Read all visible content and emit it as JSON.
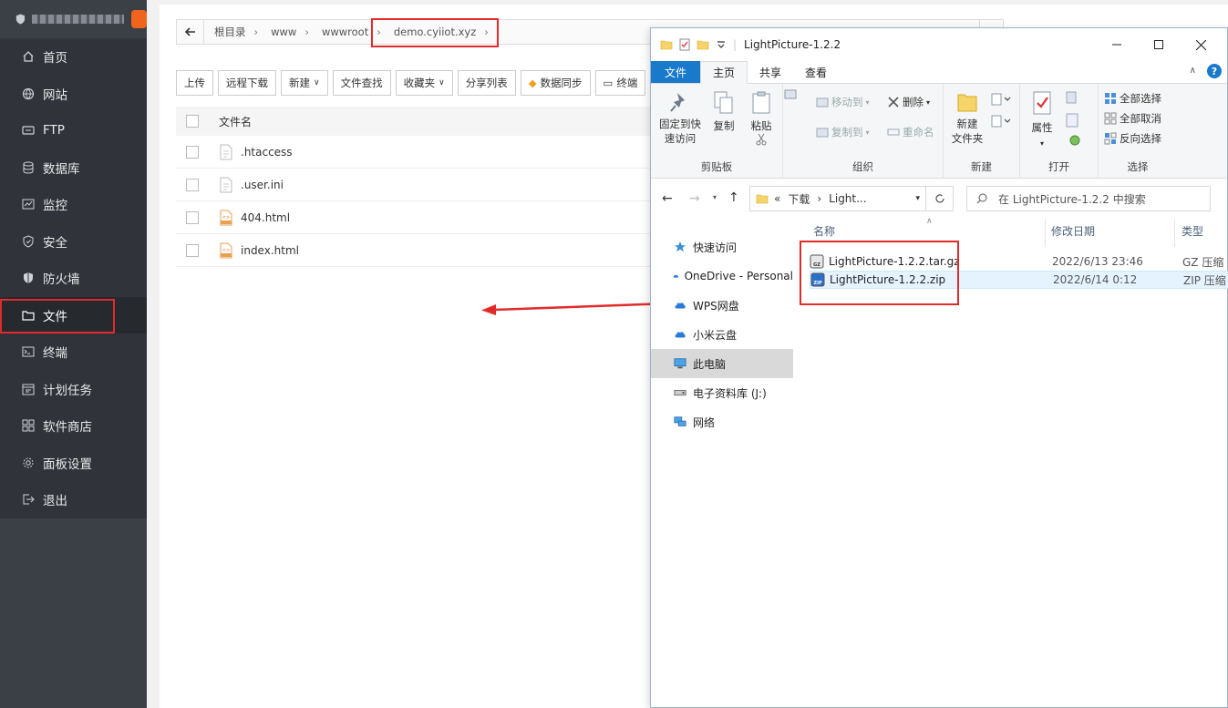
{
  "sidebar": {
    "items": [
      {
        "label": "首页",
        "icon": "home-icon"
      },
      {
        "label": "网站",
        "icon": "globe-icon"
      },
      {
        "label": "FTP",
        "icon": "ftp-icon"
      },
      {
        "label": "数据库",
        "icon": "database-icon"
      },
      {
        "label": "监控",
        "icon": "monitor-icon"
      },
      {
        "label": "安全",
        "icon": "shield-icon"
      },
      {
        "label": "防火墙",
        "icon": "firewall-icon"
      },
      {
        "label": "文件",
        "icon": "folder-icon"
      },
      {
        "label": "终端",
        "icon": "terminal-icon"
      },
      {
        "label": "计划任务",
        "icon": "calendar-icon"
      },
      {
        "label": "软件商店",
        "icon": "apps-icon"
      },
      {
        "label": "面板设置",
        "icon": "gear-icon"
      },
      {
        "label": "退出",
        "icon": "logout-icon"
      }
    ]
  },
  "filemanager": {
    "breadcrumb": [
      "根目录",
      "www",
      "wwwroot",
      "demo.cyiiot.xyz"
    ],
    "toolbar": [
      "上传",
      "远程下载",
      "新建",
      "文件查找",
      "收藏夹",
      "分享列表",
      "数据同步",
      "终端"
    ],
    "header_name": "文件名",
    "files": [
      {
        "name": ".htaccess",
        "type": "doc"
      },
      {
        "name": ".user.ini",
        "type": "doc"
      },
      {
        "name": "404.html",
        "type": "html"
      },
      {
        "name": "index.html",
        "type": "html"
      }
    ]
  },
  "explorer": {
    "title": "LightPicture-1.2.2",
    "tabs": [
      "文件",
      "主页",
      "共享",
      "查看"
    ],
    "help": "?",
    "ribbon": {
      "pin_label_1": "固定到快",
      "pin_label_2": "速访问",
      "copy": "复制",
      "paste": "粘贴",
      "clipboard_group": "剪贴板",
      "move_to": "移动到",
      "copy_to": "复制到",
      "delete": "删除",
      "rename": "重命名",
      "organize_group": "组织",
      "new_folder_1": "新建",
      "new_folder_2": "文件夹",
      "new_group": "新建",
      "properties": "属性",
      "open_group": "打开",
      "select_all": "全部选择",
      "select_none": "全部取消",
      "invert_select": "反向选择",
      "select_group": "选择"
    },
    "address": {
      "prefix": "«",
      "parts": [
        "下载",
        "Light..."
      ]
    },
    "search_placeholder": "在 LightPicture-1.2.2 中搜索",
    "nav": [
      {
        "label": "快速访问",
        "icon": "star-icon"
      },
      {
        "label": "OneDrive - Personal",
        "icon": "cloud-icon"
      },
      {
        "label": "WPS网盘",
        "icon": "cloud-icon"
      },
      {
        "label": "小米云盘",
        "icon": "cloud-icon"
      },
      {
        "label": "此电脑",
        "icon": "computer-icon"
      },
      {
        "label": "电子资料库 (J:)",
        "icon": "drive-icon"
      },
      {
        "label": "网络",
        "icon": "network-icon"
      }
    ],
    "columns": {
      "name": "名称",
      "date": "修改日期",
      "type": "类型"
    },
    "files": [
      {
        "name": "LightPicture-1.2.2.tar.gz",
        "date": "2022/6/13 23:46",
        "type": "GZ 压缩"
      },
      {
        "name": "LightPicture-1.2.2.zip",
        "date": "2022/6/14 0:12",
        "type": "ZIP 压缩"
      }
    ]
  },
  "colors": {
    "accent_blue": "#1979ca",
    "highlight_red": "#e32a2a",
    "sidebar_bg": "#30343a"
  }
}
